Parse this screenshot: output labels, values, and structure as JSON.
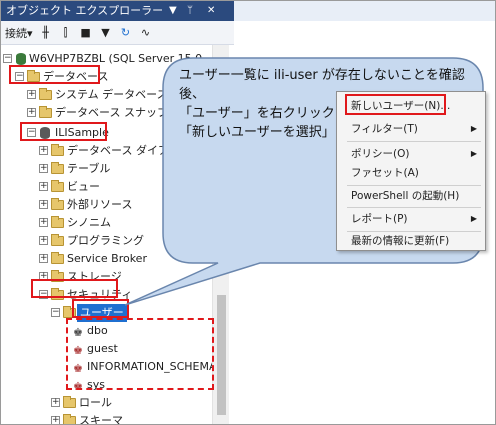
{
  "window": {
    "title": "オブジェクト エクスプローラー",
    "pin": "▼ ᛫ ✕"
  },
  "toolbar": {
    "connect": "接続▾",
    "refresh_icon": "refresh-icon"
  },
  "tree": {
    "server": "W6VHP7BZBL (SQL Server 15.0",
    "databases": "データベース",
    "system_db": "システム データベース",
    "snapshot": "データベース スナップショット",
    "ili_sample": "ILISample",
    "diagrams": "データベース ダイアグラム",
    "tables": "テーブル",
    "views": "ビュー",
    "external": "外部リソース",
    "synonyms": "シノニム",
    "programming": "プログラミング",
    "service_broker": "Service Broker",
    "storage": "ストレージ",
    "security": "セキュリティ",
    "users": "ユーザー",
    "user_dbo": "dbo",
    "user_guest": "guest",
    "user_info": "INFORMATION_SCHEMA",
    "user_sys": "sys",
    "roles": "ロール",
    "schemas": "スキーマ"
  },
  "callout": {
    "line1": "ユーザー一覧に ili-user が存在しないことを確認",
    "line2": "後、",
    "line3": "「ユーザー」を右クリックして、",
    "line4": "「新しいユーザーを選択」"
  },
  "context_menu": {
    "new_user": "新しいユーザー(N)...",
    "filter": "フィルター(T)",
    "policy": "ポリシー(O)",
    "facet": "ファセット(A)",
    "powershell": "PowerShell の起動(H)",
    "report": "レポート(P)",
    "refresh": "最新の情報に更新(F)"
  },
  "colors": {
    "title_bg": "#2b4a7e",
    "selection": "#1f6fd0",
    "highlight": "#e0181b",
    "callout_bg": "#c7d9ef"
  }
}
